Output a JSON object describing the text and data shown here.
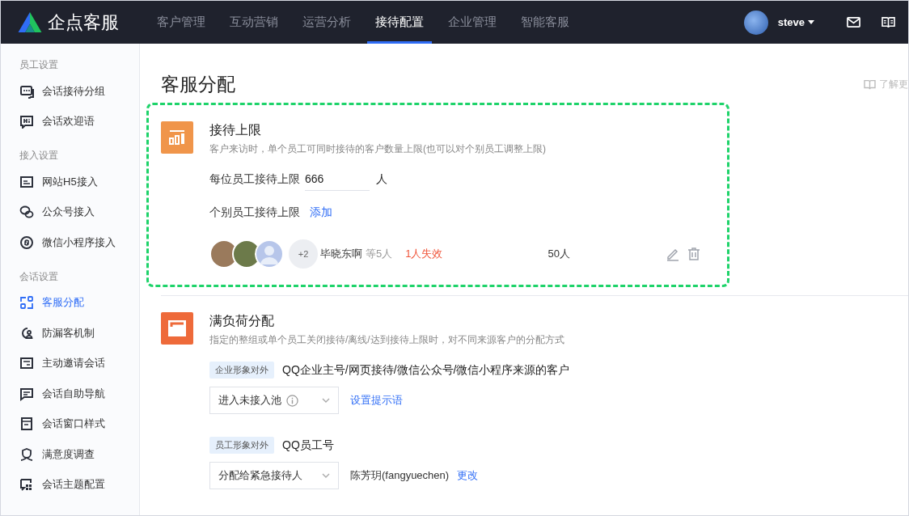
{
  "topbar": {
    "logo": "企点客服",
    "nav": [
      {
        "label": "客户管理",
        "selected": false
      },
      {
        "label": "互动营销",
        "selected": false
      },
      {
        "label": "运营分析",
        "selected": false
      },
      {
        "label": "接待配置",
        "selected": true
      },
      {
        "label": "企业管理",
        "selected": false
      },
      {
        "label": "智能客服",
        "selected": false
      }
    ],
    "user": "steve"
  },
  "sidebar": {
    "groups": [
      {
        "title": "员工设置",
        "items": [
          {
            "label": "会话接待分组",
            "kind": "chat",
            "selected": false
          },
          {
            "label": "会话欢迎语",
            "kind": "hi",
            "selected": false
          }
        ]
      },
      {
        "title": "接入设置",
        "items": [
          {
            "label": "网站H5接入",
            "kind": "web",
            "selected": false
          },
          {
            "label": "公众号接入",
            "kind": "wechat",
            "selected": false
          },
          {
            "label": "微信小程序接入",
            "kind": "mini",
            "selected": false
          }
        ]
      },
      {
        "title": "会话设置",
        "items": [
          {
            "label": "客服分配",
            "kind": "assign",
            "selected": true
          },
          {
            "label": "防漏客机制",
            "kind": "guard",
            "selected": false
          },
          {
            "label": "主动邀请会话",
            "kind": "invite",
            "selected": false
          },
          {
            "label": "会话自助导航",
            "kind": "nav",
            "selected": false
          },
          {
            "label": "会话窗口样式",
            "kind": "window",
            "selected": false
          },
          {
            "label": "满意度调查",
            "kind": "survey",
            "selected": false
          },
          {
            "label": "会话主题配置",
            "kind": "theme",
            "selected": false
          }
        ]
      }
    ]
  },
  "page": {
    "title": "客服分配",
    "help_link": "了解更"
  },
  "limit_section": {
    "highlighted": true,
    "title": "接待上限",
    "description": "客户来访时，单个员工可同时接待的客户数量上限(也可以对个别员工调整上限)",
    "per_staff_label": "每位员工接待上限",
    "per_staff_value": "666",
    "per_staff_unit": "人",
    "individual_label": "个别员工接待上限",
    "add_link": "添加",
    "rule": {
      "more_count": "+2",
      "name": "毕晓东啊",
      "extra": "等5人",
      "invalid": "1人失效",
      "limit": "50人"
    }
  },
  "overload_section": {
    "title": "满负荷分配",
    "description": "指定的整组或单个员工关闭接待/离线/达到接待上限时，对不同来源客户的分配方式",
    "rules": [
      {
        "tag": "企业形象对外",
        "sources": "QQ企业主号/网页接待/微信公众号/微信小程序来源的客户",
        "select": "进入未接入池",
        "info": true,
        "link": "设置提示语"
      },
      {
        "tag": "员工形象对外",
        "sources": "QQ员工号",
        "select": "分配给紧急接待人",
        "info": false,
        "assignee": "陈芳玥(fangyuechen)",
        "link": "更改"
      }
    ]
  }
}
